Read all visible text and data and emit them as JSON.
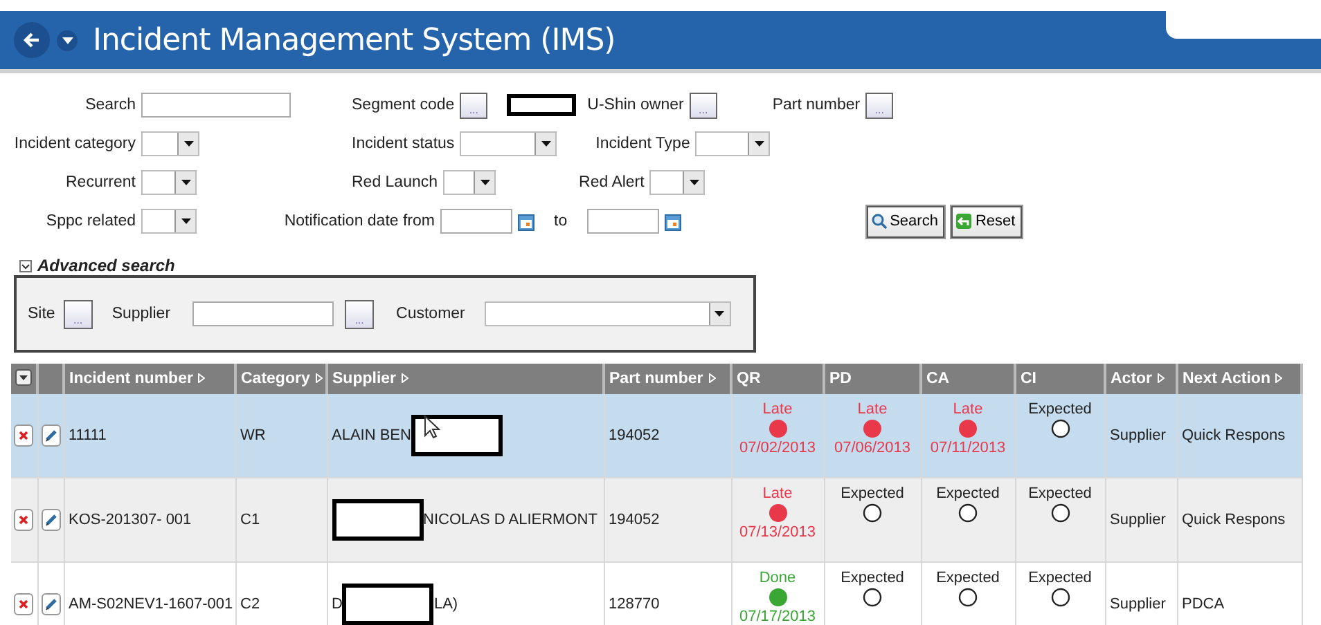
{
  "header": {
    "title": "Incident Management System (IMS)"
  },
  "filters": {
    "search": {
      "label": "Search"
    },
    "segment_code": {
      "label": "Segment code",
      "button": "...",
      "redacted": true
    },
    "ushin_owner": {
      "label": "U-Shin owner",
      "button": "..."
    },
    "part_number": {
      "label": "Part number",
      "button": "..."
    },
    "incident_category": {
      "label": "Incident category"
    },
    "incident_status": {
      "label": "Incident status"
    },
    "incident_type": {
      "label": "Incident Type"
    },
    "recurrent": {
      "label": "Recurrent"
    },
    "red_launch": {
      "label": "Red Launch"
    },
    "red_alert": {
      "label": "Red Alert"
    },
    "sppc_related": {
      "label": "Sppc related"
    },
    "notification_date": {
      "label": "Notification date from",
      "to_label": "to"
    },
    "buttons": [
      {
        "label": "Search",
        "kind": "search"
      },
      {
        "label": "Reset",
        "kind": "reset"
      }
    ]
  },
  "advanced": {
    "label": "Advanced search",
    "expanded": true,
    "site": {
      "label": "Site",
      "button": "..."
    },
    "supplier": {
      "label": "Supplier",
      "button": "..."
    },
    "customer": {
      "label": "Customer"
    }
  },
  "table": {
    "columns": [
      {
        "kind": "menu"
      },
      {
        "kind": "blank"
      },
      {
        "kind": "text",
        "label": "Incident number",
        "sortable": true
      },
      {
        "kind": "text",
        "label": "Category",
        "sortable": true
      },
      {
        "kind": "text",
        "label": "Supplier",
        "sortable": true
      },
      {
        "kind": "text",
        "label": "Part number",
        "sortable": true
      },
      {
        "kind": "text",
        "label": "QR",
        "sortable": false
      },
      {
        "kind": "text",
        "label": "PD",
        "sortable": false
      },
      {
        "kind": "text",
        "label": "CA",
        "sortable": false
      },
      {
        "kind": "text",
        "label": "CI",
        "sortable": false
      },
      {
        "kind": "text",
        "label": "Actor",
        "sortable": true
      },
      {
        "kind": "text",
        "label": "Next Action",
        "sortable": true
      }
    ],
    "rows": [
      {
        "selected": true,
        "incident_number": "11111",
        "category": "WR",
        "supplier": [
          {
            "kind": "text",
            "text": "ALAIN BEN"
          },
          {
            "kind": "redacted"
          }
        ],
        "part_number": "194052",
        "steps": [
          {
            "kind": "filled",
            "color": "#e8384a",
            "label": "Late",
            "date": "07/02/2013"
          },
          {
            "kind": "filled",
            "color": "#e8384a",
            "label": "Late",
            "date": "07/06/2013"
          },
          {
            "kind": "filled",
            "color": "#e8384a",
            "label": "Late",
            "date": "07/11/2013"
          },
          {
            "kind": "empty",
            "label": "Expected"
          }
        ],
        "actor": "Supplier",
        "next_action": "Quick Respons"
      },
      {
        "selected": false,
        "incident_number": "KOS-201307- 001",
        "category": "C1",
        "supplier": [
          {
            "kind": "redacted"
          },
          {
            "kind": "text",
            "text": "NICOLAS D ALIERMONT"
          }
        ],
        "part_number": "194052",
        "steps": [
          {
            "kind": "filled",
            "color": "#e8384a",
            "label": "Late",
            "date": "07/13/2013"
          },
          {
            "kind": "empty",
            "label": "Expected"
          },
          {
            "kind": "empty",
            "label": "Expected"
          },
          {
            "kind": "empty",
            "label": "Expected"
          }
        ],
        "actor": "Supplier",
        "next_action": "Quick Respons"
      },
      {
        "selected": false,
        "incident_number": "AM-S02NEV1-1607-001",
        "category": "C2",
        "supplier": [
          {
            "kind": "text",
            "text": "D"
          },
          {
            "kind": "redacted"
          },
          {
            "kind": "text",
            "text": "LA)"
          }
        ],
        "part_number": "128770",
        "steps": [
          {
            "kind": "filled",
            "color": "#3aa634",
            "label": "Done",
            "date": "07/17/2013"
          },
          {
            "kind": "empty",
            "label": "Expected"
          },
          {
            "kind": "empty",
            "label": "Expected"
          },
          {
            "kind": "empty",
            "label": "Expected"
          }
        ],
        "actor": "Supplier",
        "next_action": "PDCA"
      }
    ]
  }
}
